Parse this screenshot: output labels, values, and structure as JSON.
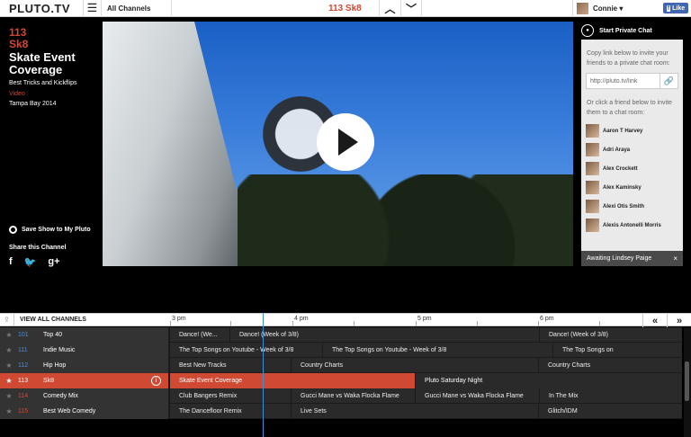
{
  "topbar": {
    "logo": "PLUTO.TV",
    "menu_icon": "hamburger-icon",
    "all_channels": "All Channels",
    "now_title": "113 Sk8",
    "user_name": "Connie ▾",
    "fb_like": "Like"
  },
  "now_playing": {
    "channel_number": "113",
    "channel_name": "Sk8",
    "title": "Skate Event Coverage",
    "subtitle": "Best Tricks and Kickflips",
    "category": "Video",
    "location": "Tampa Bay 2014",
    "save_label": "Save Show to My Pluto",
    "share_label": "Share this Channel"
  },
  "chat": {
    "header": "Start Private Chat",
    "invite_text": "Copy link below to invite your friends to a private chat room:",
    "link_value": "http://pluto.tv/link",
    "friends_text": "Or click a friend below to invite them to a chat room:",
    "friends": [
      {
        "name": "Aaron T Harvey"
      },
      {
        "name": "Adri Araya"
      },
      {
        "name": "Alex Crockett"
      },
      {
        "name": "Alex Kaminsky"
      },
      {
        "name": "Alexi Otis Smith"
      },
      {
        "name": "Alexis Antonelli Morris"
      }
    ],
    "awaiting": "Awaiting Lindsey Paige",
    "close": "×"
  },
  "guide": {
    "view_all": "VIEW ALL CHANNELS",
    "times": [
      "3 pm",
      "4 pm",
      "5 pm",
      "6 pm"
    ],
    "rows": [
      {
        "num": "101",
        "name": "Top 40",
        "active": false,
        "programs": [
          "Dance! (We...",
          "Dance! (Week of 3/8)",
          "Dance! (Week of 3/8)"
        ]
      },
      {
        "num": "111",
        "name": "Indie Music",
        "active": false,
        "programs": [
          "The Top Songs on Youtube - Week of 3/8",
          "The Top Songs on Youtube - Week of 3/8",
          "The Top Songs on"
        ]
      },
      {
        "num": "112",
        "name": "Hip Hop",
        "active": false,
        "programs": [
          "Best New Tracks",
          "Country Charts",
          "Country Charts"
        ]
      },
      {
        "num": "113",
        "name": "Sk8",
        "active": true,
        "programs": [
          "Skate Event Coverage",
          "Pluto Saturday Night"
        ]
      },
      {
        "num": "114",
        "name": "Comedy Mix",
        "active": false,
        "programs": [
          "Club Bangers Remix",
          "Gucci Mane vs Waka Flocka Flame",
          "Gucci Mane vs Waka Flocka Flame",
          "In The Mix"
        ]
      },
      {
        "num": "115",
        "name": "Best Web Comedy",
        "active": false,
        "programs": [
          "The Dancefloor Remix",
          "Live Sets",
          "Glitch/IDM"
        ]
      }
    ]
  },
  "colors": {
    "accent": "#d8452e",
    "channel_num": "#4a8fd6",
    "now_line": "#3a8fd8"
  }
}
